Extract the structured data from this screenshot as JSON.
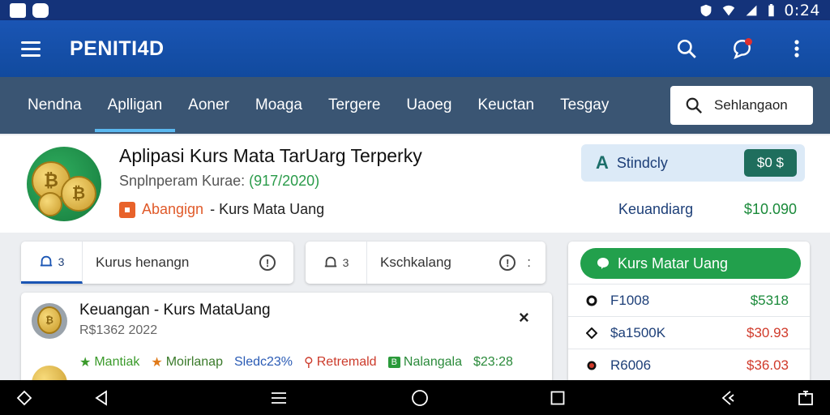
{
  "status_bar": {
    "time": "0:24",
    "icons": [
      "image-icon",
      "app-icon",
      "shield-icon",
      "wifi-icon",
      "signal-icon",
      "battery-icon"
    ]
  },
  "app_bar": {
    "title": "PENITI4D",
    "icons": [
      "menu-icon",
      "search-icon",
      "chat-notification-icon",
      "more-vert-icon"
    ]
  },
  "tabs": [
    {
      "label": "Nendna",
      "active": false
    },
    {
      "label": "Aplligan",
      "active": true
    },
    {
      "label": "Aoner",
      "active": false
    },
    {
      "label": "Moaga",
      "active": false
    },
    {
      "label": "Tergere",
      "active": false
    },
    {
      "label": "Uaoeg",
      "active": false
    },
    {
      "label": "Keuctan",
      "active": false
    },
    {
      "label": "Tesgay",
      "active": false
    }
  ],
  "search": {
    "label": "Sehlangaon"
  },
  "hero": {
    "title": "Aplipasi Kurs Mata TarUarg Terperky",
    "subtitle_prefix": "Snplnperam Kurae:",
    "subtitle_date": "(917/2020)",
    "tag_name": "Abangign",
    "tag_text": "- Kurs Mata Uang",
    "status_letter": "A",
    "status_label": "Stindcly",
    "status_price": "$0 $",
    "row_label": "Keuandiarg",
    "row_value": "$10.090"
  },
  "chips": [
    {
      "count": "3",
      "label": "Kurus henangn"
    },
    {
      "count": "3",
      "label": "Kschkalang",
      "extra": ":"
    }
  ],
  "list_item": {
    "title": "Keuangan - Kurs MataUang",
    "subtitle": "R$1362 2022",
    "close": "×",
    "meta": [
      {
        "icon": "star-icon",
        "text": "Mantiak"
      },
      {
        "icon": "star-icon",
        "text": "Moirlanap"
      },
      {
        "icon": "",
        "text": "Sledc23%"
      },
      {
        "icon": "pin-icon",
        "text": "Retremald"
      },
      {
        "icon": "b-badge-icon",
        "text": "Nalangala"
      },
      {
        "icon": "",
        "text": "$23:28"
      }
    ]
  },
  "rates_panel": {
    "button_label": "Kurs Matar Uang",
    "rows": [
      {
        "icon": "dot-icon",
        "name": "F1008",
        "value": "$5318",
        "color": "#1a8a3a"
      },
      {
        "icon": "diamond-icon",
        "name": "$a1500K",
        "value": "$30.93",
        "color": "#d03a2a"
      },
      {
        "icon": "red-dot-icon",
        "name": "R6006",
        "value": "$36.03",
        "color": "#d03a2a"
      }
    ]
  },
  "nav_bar": {
    "icons": [
      "diamond-nav-icon",
      "back-icon",
      "menu-nav-icon",
      "home-icon",
      "recents-icon",
      "share-icon",
      "rotate-icon"
    ]
  },
  "colors": {
    "primary": "#1a55b4",
    "tabbar": "#3a5573",
    "accent_green": "#22a04c"
  }
}
